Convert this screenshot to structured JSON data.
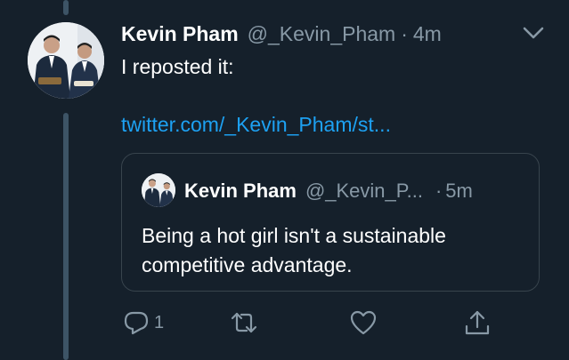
{
  "tweet": {
    "author_name": "Kevin Pham",
    "author_handle": "@_Kevin_Pham",
    "separator": "·",
    "time": "4m",
    "text": "I reposted it:",
    "link": "twitter.com/_Kevin_Pham/st..."
  },
  "quote": {
    "author_name": "Kevin Pham",
    "author_handle": "@_Kevin_P...",
    "separator": "·",
    "time": "5m",
    "text": "Being a hot girl isn't a sustainable competitive advantage."
  },
  "actions": {
    "reply_count": "1"
  },
  "icons": {
    "menu": "chevron-down-icon",
    "reply": "reply-icon",
    "retweet": "retweet-icon",
    "like": "heart-icon",
    "share": "share-icon"
  },
  "colors": {
    "background": "#15202b",
    "text_primary": "#ffffff",
    "text_secondary": "#8899a6",
    "link": "#1da1f2",
    "border": "#38444d",
    "thread_line": "#3d5466"
  }
}
